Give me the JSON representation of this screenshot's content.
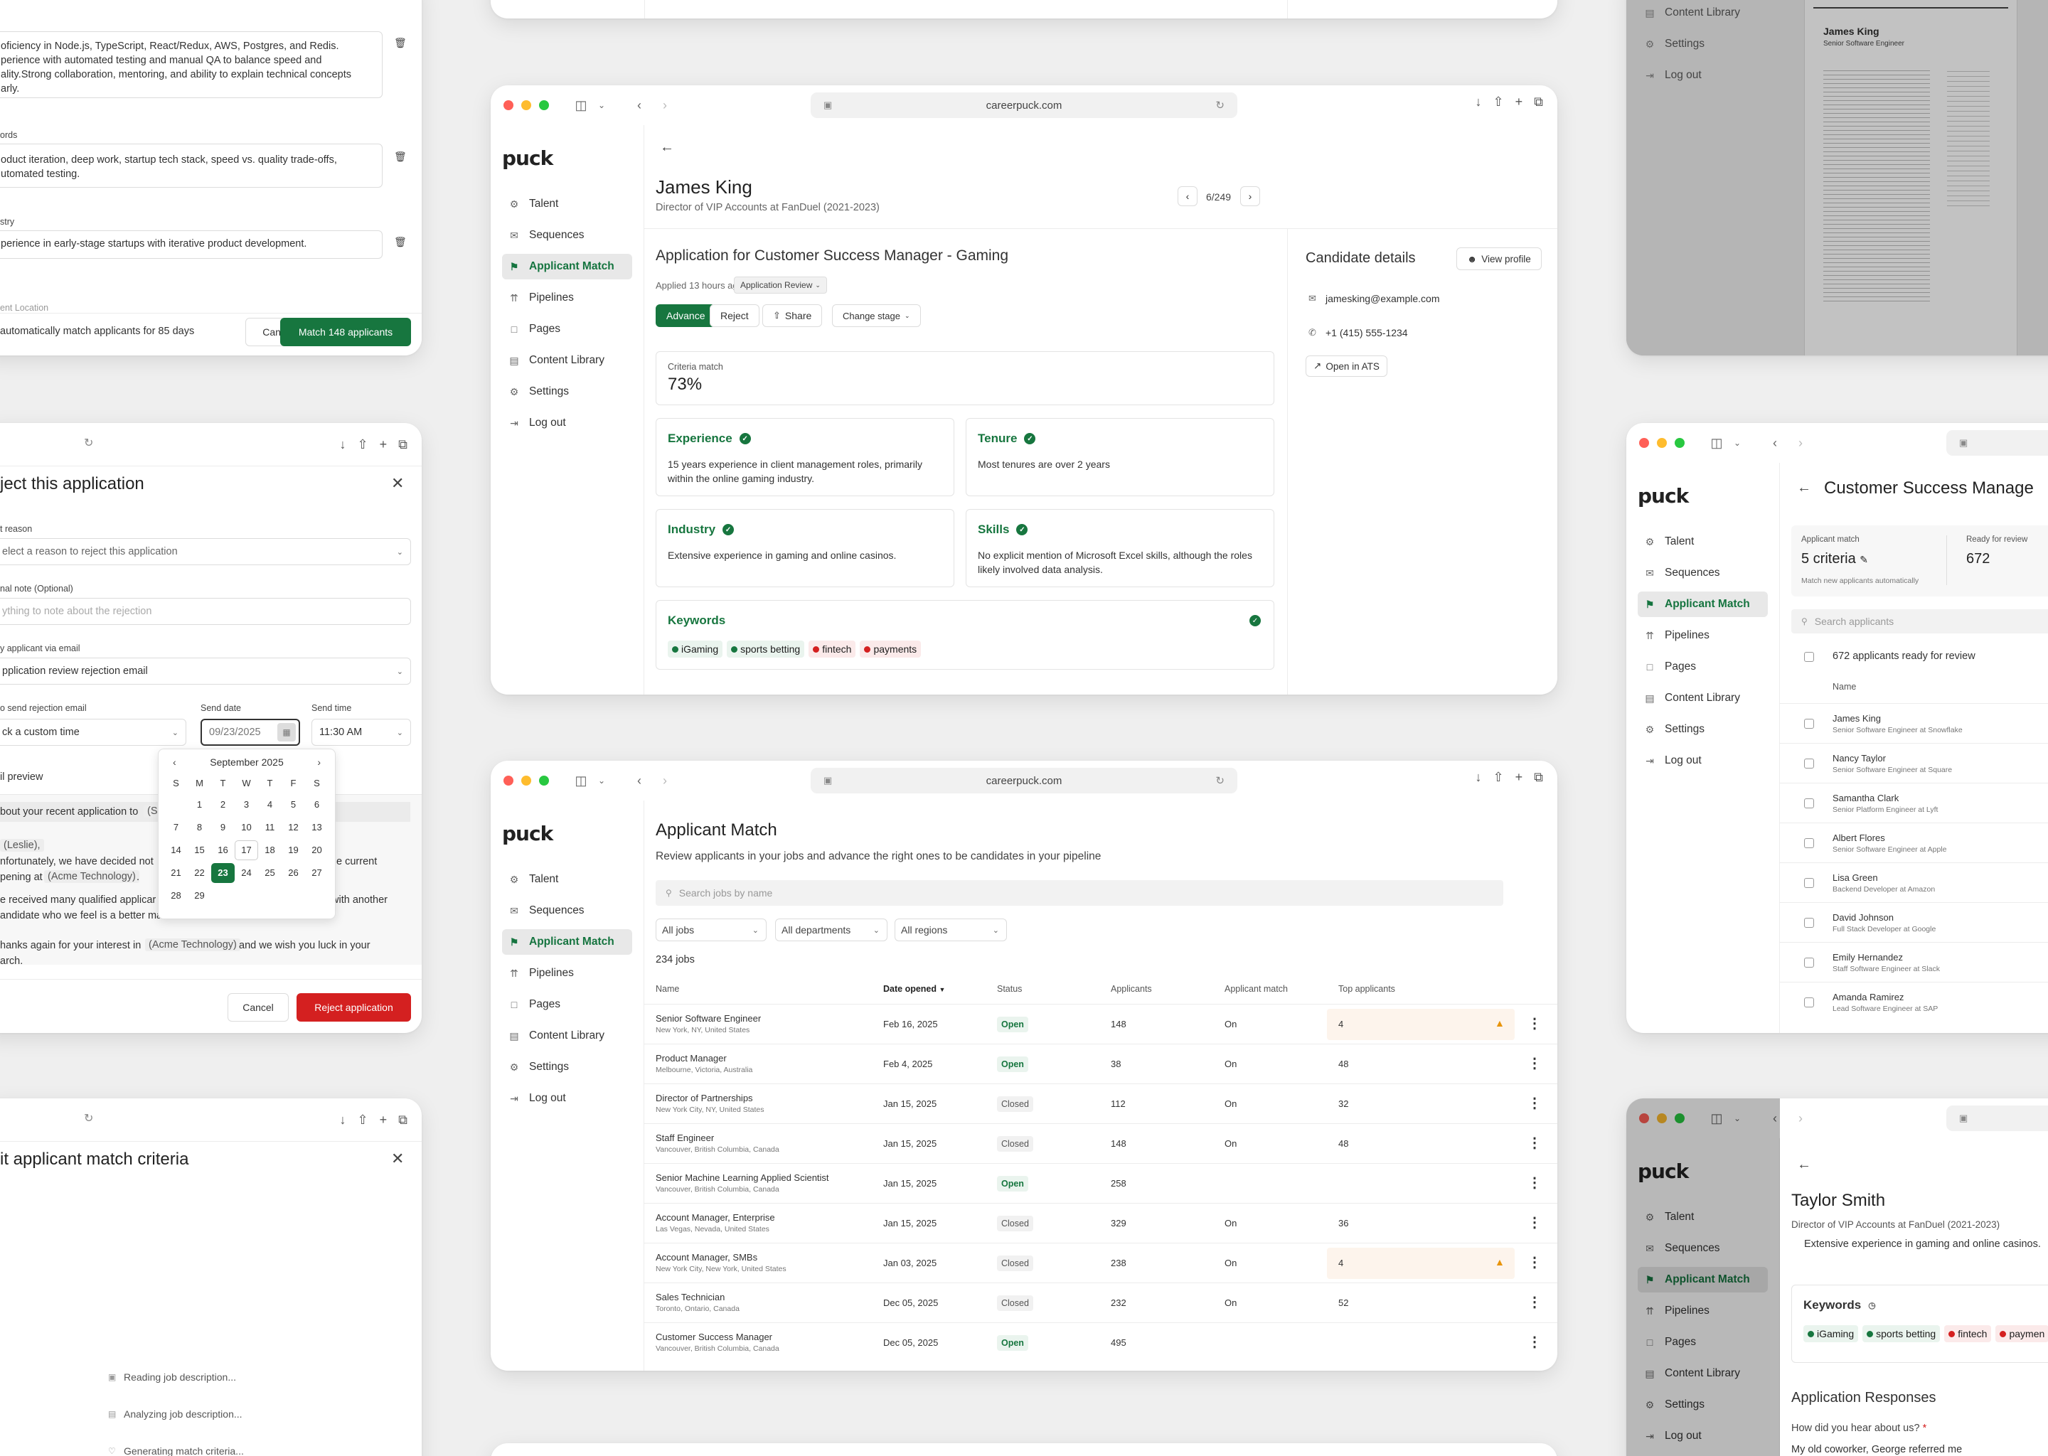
{
  "browser": {
    "url": "careerpuck.com"
  },
  "brand": {
    "logo": "puck"
  },
  "nav": [
    "Talent",
    "Sequences",
    "Applicant Match",
    "Pipelines",
    "Pages",
    "Content Library",
    "Settings",
    "Log out"
  ],
  "colors": {
    "accent": "#17763f",
    "danger": "#d42020",
    "warning": "#e8940a"
  },
  "match_modal": {
    "criteria": [
      {
        "text": "oficiency in Node.js, TypeScript, React/Redux, AWS, Postgres, and Redis. perience with automated testing and manual QA to balance speed and ality.Strong collaboration, mentoring, and ability to explain technical concepts arly."
      },
      {
        "label": "ords",
        "text": "oduct iteration, deep work, startup tech stack, speed vs. quality trade-offs, utomated testing."
      },
      {
        "label": "stry",
        "text": "perience in early-stage startups with iterative product development."
      }
    ],
    "cut_label": "ent Location",
    "footer_text": "automatically match applicants for 85 days",
    "cancel": "Cancel",
    "confirm": "Match 148 applicants"
  },
  "reject_modal": {
    "title": "ject this application",
    "reason_label": "t reason",
    "reason_placeholder": "elect a reason to reject this application",
    "note_label": "nal note (Optional)",
    "note_placeholder": "ything to note about the rejection",
    "notify_label": "y applicant via email",
    "notify_value": "pplication review rejection email",
    "when_label": "o send rejection email",
    "when_value": "ck a custom time",
    "date_label": "Send date",
    "date_value": "09/23/2025",
    "time_label": "Send time",
    "time_value": "11:30 AM",
    "preview_label": "il preview",
    "email_lines": [
      "bout your recent application to",
      "(Leslie),",
      "nfortunately, we have decided not",
      "e current",
      "pening at",
      "(Acme Technology)",
      ".",
      "e received many qualified applicar",
      "with another",
      "andidate who we feel is a better ma",
      "hanks again for your interest in",
      "(Acme Technology)",
      "and we wish you luck in your",
      "arch.",
      "(Sa"
    ],
    "cancel": "Cancel",
    "confirm": "Reject application",
    "calendar": {
      "month": "September 2025",
      "days": [
        "S",
        "M",
        "T",
        "W",
        "T",
        "F",
        "S"
      ],
      "dates": [
        "",
        "1",
        "2",
        "3",
        "4",
        "5",
        "6",
        "7",
        "8",
        "9",
        "10",
        "11",
        "12",
        "13",
        "14",
        "15",
        "16",
        "17",
        "18",
        "19",
        "20",
        "21",
        "22",
        "23",
        "24",
        "25",
        "26",
        "27",
        "28",
        "29"
      ],
      "selected": "23",
      "today": "17"
    }
  },
  "criteria_modal": {
    "title": "it applicant match criteria",
    "steps": [
      "Reading job description...",
      "Analyzing job description...",
      "Generating match criteria..."
    ]
  },
  "resume": {
    "name": "James King",
    "title": "Senior Software Engineer"
  },
  "application": {
    "candidate": "James King",
    "headline": "Director of VIP Accounts at FanDuel (2021-2023)",
    "pager": "6/249",
    "app_title": "Application for Customer Success Manager - Gaming",
    "applied": "Applied 13 hours ago",
    "stage": "Application Review",
    "advance": "Advance",
    "reject": "Reject",
    "share": "Share",
    "change_stage": "Change stage",
    "criteria_label": "Criteria match",
    "criteria_value": "73%",
    "cards": [
      {
        "title": "Experience",
        "text": "15 years experience in client management roles, primarily within the online gaming industry."
      },
      {
        "title": "Tenure",
        "text": "Most tenures are over 2 years"
      },
      {
        "title": "Industry",
        "text": "Extensive experience in gaming and online casinos."
      },
      {
        "title": "Skills",
        "text": "No explicit mention of Microsoft Excel skills, although the roles likely involved data analysis."
      }
    ],
    "keywords_title": "Keywords",
    "keywords": [
      {
        "k": "iGaming",
        "ok": true
      },
      {
        "k": "sports betting",
        "ok": true
      },
      {
        "k": "fintech",
        "ok": false
      },
      {
        "k": "payments",
        "ok": false
      }
    ],
    "details_title": "Candidate details",
    "view_profile": "View profile",
    "email": "jamesking@example.com",
    "phone": "+1 (415) 555-1234",
    "open_ats": "Open in ATS"
  },
  "applicant_match": {
    "title": "Applicant Match",
    "subtitle": "Review applicants in your jobs and advance the right ones to be candidates in your pipeline",
    "search_placeholder": "Search jobs by name",
    "filters": [
      "All jobs",
      "All departments",
      "All regions"
    ],
    "count": "234 jobs",
    "columns": [
      "Name",
      "Date opened",
      "Status",
      "Applicants",
      "Applicant match",
      "Top applicants"
    ],
    "rows": [
      {
        "name": "Senior Software Engineer",
        "loc": "New York, NY, United States",
        "date": "Feb 16, 2025",
        "status": "Open",
        "applicants": "148",
        "match": "On",
        "top": "4",
        "warn": true
      },
      {
        "name": "Product Manager",
        "loc": "Melbourne, Victoria, Australia",
        "date": "Feb 4, 2025",
        "status": "Open",
        "applicants": "38",
        "match": "On",
        "top": "48",
        "warn": false
      },
      {
        "name": "Director of Partnerships",
        "loc": "New York City, NY, United States",
        "date": "Jan 15, 2025",
        "status": "Closed",
        "applicants": "112",
        "match": "On",
        "top": "32",
        "warn": false
      },
      {
        "name": "Staff Engineer",
        "loc": "Vancouver, British Columbia, Canada",
        "date": "Jan 15, 2025",
        "status": "Closed",
        "applicants": "148",
        "match": "On",
        "top": "48",
        "warn": false
      },
      {
        "name": "Senior Machine Learning Applied Scientist",
        "loc": "Vancouver, British Columbia, Canada",
        "date": "Jan 15, 2025",
        "status": "Open",
        "applicants": "258",
        "match": "",
        "top": "",
        "warn": false
      },
      {
        "name": "Account Manager, Enterprise",
        "loc": "Las Vegas, Nevada, United States",
        "date": "Jan 15, 2025",
        "status": "Closed",
        "applicants": "329",
        "match": "On",
        "top": "36",
        "warn": false
      },
      {
        "name": "Account Manager, SMBs",
        "loc": "New York City, New York, United States",
        "date": "Jan 03, 2025",
        "status": "Closed",
        "applicants": "238",
        "match": "On",
        "top": "4",
        "warn": true
      },
      {
        "name": "Sales Technician",
        "loc": "Toronto, Ontario, Canada",
        "date": "Dec 05, 2025",
        "status": "Closed",
        "applicants": "232",
        "match": "On",
        "top": "52",
        "warn": false
      },
      {
        "name": "Customer Success Manager",
        "loc": "Vancouver, British Columbia, Canada",
        "date": "Dec 05, 2025",
        "status": "Open",
        "applicants": "495",
        "match": "",
        "top": "",
        "warn": false
      }
    ]
  },
  "job_match": {
    "title": "Customer Success Manage",
    "match_label": "Applicant match",
    "match_value": "5 criteria",
    "match_note": "Match new applicants automatically",
    "ready_label": "Ready for review",
    "ready_value": "672",
    "search_placeholder": "Search applicants",
    "select_all": "672 applicants ready for review",
    "name_col": "Name",
    "applicants": [
      {
        "name": "James King",
        "sub": "Senior Software Engineer at Snowflake"
      },
      {
        "name": "Nancy Taylor",
        "sub": "Senior Software Engineer at Square"
      },
      {
        "name": "Samantha Clark",
        "sub": "Senior Platform Engineer at Lyft"
      },
      {
        "name": "Albert Flores",
        "sub": "Senior Software Engineer at Apple"
      },
      {
        "name": "Lisa Green",
        "sub": "Backend Developer at Amazon"
      },
      {
        "name": "David Johnson",
        "sub": "Full Stack Developer at Google"
      },
      {
        "name": "Emily Hernandez",
        "sub": "Staff Software Engineer at Slack"
      },
      {
        "name": "Amanda Ramirez",
        "sub": "Lead Software Engineer at SAP"
      }
    ]
  },
  "taylor": {
    "name": "Taylor Smith",
    "headline": "Director of VIP Accounts at FanDuel (2021-2023)",
    "snippet": "Extensive experience in gaming and online casinos.",
    "keywords_title": "Keywords",
    "keywords": [
      {
        "k": "iGaming",
        "ok": true
      },
      {
        "k": "sports betting",
        "ok": true
      },
      {
        "k": "fintech",
        "ok": false
      },
      {
        "k": "paymen",
        "ok": false
      }
    ],
    "responses_title": "Application Responses",
    "question": "How did you hear about us?",
    "answer": "My old coworker, George referred me"
  }
}
